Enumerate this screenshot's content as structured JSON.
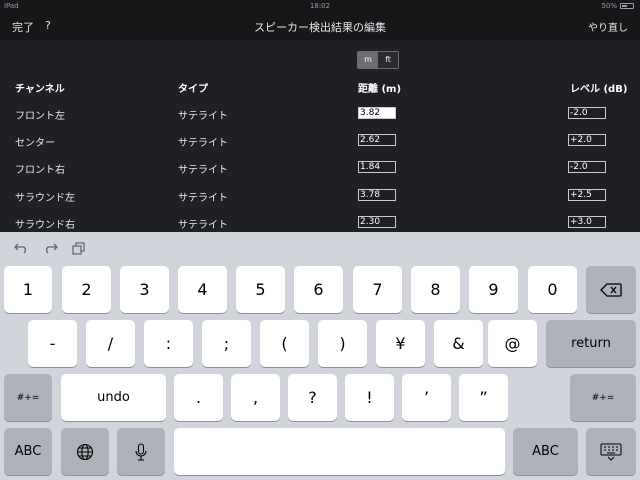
{
  "status": {
    "device": "iPad",
    "time": "18:02",
    "battery": "50%"
  },
  "nav": {
    "done": "完了",
    "help": "?",
    "title": "スピーカー検出結果の編集",
    "redo": "やり直し"
  },
  "units": {
    "m": "m",
    "ft": "ft",
    "selected": "m"
  },
  "table": {
    "headers": {
      "channel": "チャンネル",
      "type": "タイプ",
      "distance": "距離 (m)",
      "level": "レベル (dB)"
    },
    "rows": [
      {
        "channel": "フロント左",
        "type": "サテライト",
        "distance": "3.82",
        "level": "-2.0"
      },
      {
        "channel": "センター",
        "type": "サテライト",
        "distance": "2.62",
        "level": "+2.0"
      },
      {
        "channel": "フロント右",
        "type": "サテライト",
        "distance": "1.84",
        "level": "-2.0"
      },
      {
        "channel": "サラウンド左",
        "type": "サテライト",
        "distance": "3.78",
        "level": "+2.5"
      },
      {
        "channel": "サラウンド右",
        "type": "サテライト",
        "distance": "2.30",
        "level": "+3.0"
      }
    ]
  },
  "keyboard": {
    "row1": [
      "1",
      "2",
      "3",
      "4",
      "5",
      "6",
      "7",
      "8",
      "9",
      "0"
    ],
    "row2": [
      "-",
      "/",
      ":",
      ";",
      "(",
      ")",
      "¥",
      "&",
      "@"
    ],
    "row3": [
      ".",
      ",",
      "?",
      "!",
      "’",
      "”"
    ],
    "return": "return",
    "symbols": "#+=",
    "undo": "undo",
    "abc": "ABC"
  },
  "colors": {
    "background": "#1f2023",
    "navbar": "#161719",
    "keyboard": "#d1d4da",
    "key": "#ffffff",
    "key_dark": "#adb1b9"
  }
}
